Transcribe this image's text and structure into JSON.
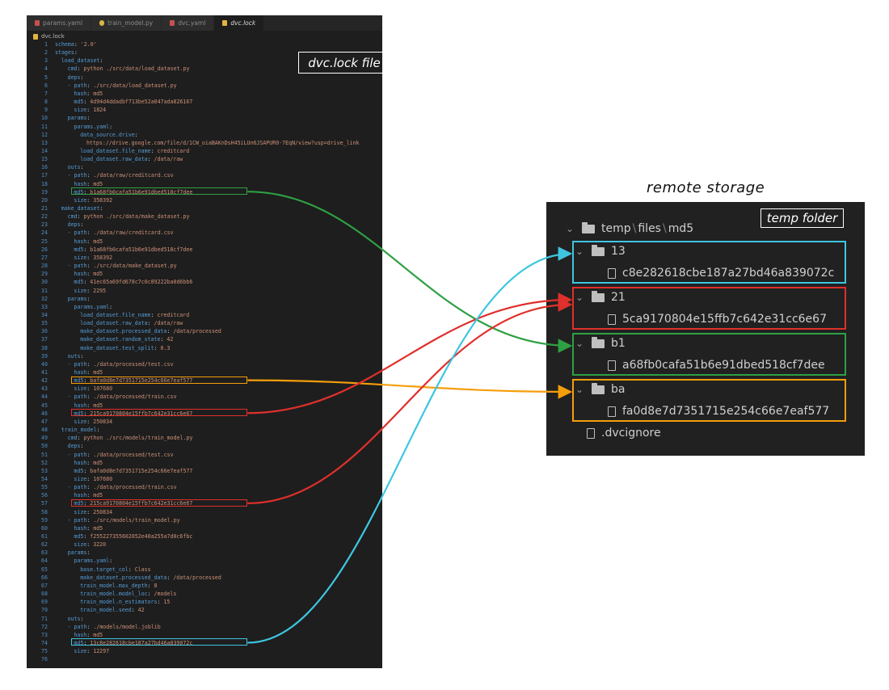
{
  "tabs": [
    {
      "label": "params.yaml",
      "icon": "yaml-icon",
      "active": false
    },
    {
      "label": "train_model.py",
      "icon": "python-icon",
      "active": false
    },
    {
      "label": "dvc.yaml",
      "icon": "yaml-icon",
      "active": false
    },
    {
      "label": "dvc.lock",
      "icon": "lock-icon",
      "active": true
    }
  ],
  "breadcrumb": "dvc.lock",
  "dvc_label": "dvc.lock file",
  "code_lines": [
    {
      "n": "1",
      "i": 0,
      "k": "schema",
      "v": "'2.0'"
    },
    {
      "n": "2",
      "i": 0,
      "k": "stages",
      "v": ""
    },
    {
      "n": "3",
      "i": 1,
      "k": "load_dataset",
      "v": ""
    },
    {
      "n": "4",
      "i": 2,
      "k": "cmd",
      "v": "python ./src/data/load_dataset.py"
    },
    {
      "n": "5",
      "i": 2,
      "k": "deps",
      "v": ""
    },
    {
      "n": "6",
      "i": 2,
      "k": "- path",
      "v": "./src/data/load_dataset.py"
    },
    {
      "n": "7",
      "i": 3,
      "k": "hash",
      "v": "md5"
    },
    {
      "n": "8",
      "i": 3,
      "k": "md5",
      "v": "4d94d4ddadbf713be52a047ada826167"
    },
    {
      "n": "9",
      "i": 3,
      "k": "size",
      "v": "1824"
    },
    {
      "n": "10",
      "i": 2,
      "k": "params",
      "v": ""
    },
    {
      "n": "11",
      "i": 3,
      "k": "params.yaml",
      "v": ""
    },
    {
      "n": "12",
      "i": 4,
      "k": "data_source.drive",
      "v": ""
    },
    {
      "n": "13",
      "i": 5,
      "k": "",
      "v": "https://drive.google.com/file/d/1CW_oiaBAKnDsH45iLUn6JSAPUR0-7EqN/view?usp=drive_link"
    },
    {
      "n": "14",
      "i": 4,
      "k": "load_dataset.file_name",
      "v": "creditcard"
    },
    {
      "n": "15",
      "i": 4,
      "k": "load_dataset.raw_data",
      "v": "/data/raw"
    },
    {
      "n": "16",
      "i": 2,
      "k": "outs",
      "v": ""
    },
    {
      "n": "17",
      "i": 2,
      "k": "- path",
      "v": "./data/raw/creditcard.csv"
    },
    {
      "n": "18",
      "i": 3,
      "k": "hash",
      "v": "md5"
    },
    {
      "n": "19",
      "i": 3,
      "k": "md5",
      "v": "b1a68fb0cafa51b6e91dbed518cf7dee"
    },
    {
      "n": "20",
      "i": 3,
      "k": "size",
      "v": "358392"
    },
    {
      "n": "21",
      "i": 1,
      "k": "make_dataset",
      "v": ""
    },
    {
      "n": "22",
      "i": 2,
      "k": "cmd",
      "v": "python ./src/data/make_dataset.py"
    },
    {
      "n": "23",
      "i": 2,
      "k": "deps",
      "v": ""
    },
    {
      "n": "24",
      "i": 2,
      "k": "- path",
      "v": "./data/raw/creditcard.csv"
    },
    {
      "n": "25",
      "i": 3,
      "k": "hash",
      "v": "md5"
    },
    {
      "n": "26",
      "i": 3,
      "k": "md5",
      "v": "b1a68fb0cafa51b6e91dbed518cf7dee"
    },
    {
      "n": "27",
      "i": 3,
      "k": "size",
      "v": "358392"
    },
    {
      "n": "28",
      "i": 2,
      "k": "- path",
      "v": "./src/data/make_dataset.py"
    },
    {
      "n": "29",
      "i": 3,
      "k": "hash",
      "v": "md5"
    },
    {
      "n": "30",
      "i": 3,
      "k": "md5",
      "v": "41ec65a69fd678c7c0c89222ba0d6bb6"
    },
    {
      "n": "31",
      "i": 3,
      "k": "size",
      "v": "2295"
    },
    {
      "n": "32",
      "i": 2,
      "k": "params",
      "v": ""
    },
    {
      "n": "33",
      "i": 3,
      "k": "params.yaml",
      "v": ""
    },
    {
      "n": "34",
      "i": 4,
      "k": "load_dataset.file_name",
      "v": "creditcard"
    },
    {
      "n": "35",
      "i": 4,
      "k": "load_dataset.raw_data",
      "v": "/data/raw"
    },
    {
      "n": "36",
      "i": 4,
      "k": "make_dataset.processed_data",
      "v": "/data/processed"
    },
    {
      "n": "37",
      "i": 4,
      "k": "make_dataset.random_state",
      "v": "42"
    },
    {
      "n": "38",
      "i": 4,
      "k": "make_dataset.test_split",
      "v": "0.3"
    },
    {
      "n": "39",
      "i": 2,
      "k": "outs",
      "v": ""
    },
    {
      "n": "40",
      "i": 2,
      "k": "- path",
      "v": "./data/processed/test.csv"
    },
    {
      "n": "41",
      "i": 3,
      "k": "hash",
      "v": "md5"
    },
    {
      "n": "42",
      "i": 3,
      "k": "md5",
      "v": "bafa0d8e7d7351715e254c66e7eaf577"
    },
    {
      "n": "43",
      "i": 3,
      "k": "size",
      "v": "107680"
    },
    {
      "n": "44",
      "i": 2,
      "k": "- path",
      "v": "./data/processed/train.csv"
    },
    {
      "n": "45",
      "i": 3,
      "k": "hash",
      "v": "md5"
    },
    {
      "n": "46",
      "i": 3,
      "k": "md5",
      "v": "215ca9170804e15ffb7c642e31cc6e67"
    },
    {
      "n": "47",
      "i": 3,
      "k": "size",
      "v": "250834"
    },
    {
      "n": "48",
      "i": 1,
      "k": "train_model",
      "v": ""
    },
    {
      "n": "49",
      "i": 2,
      "k": "cmd",
      "v": "python ./src/models/train_model.py"
    },
    {
      "n": "50",
      "i": 2,
      "k": "deps",
      "v": ""
    },
    {
      "n": "51",
      "i": 2,
      "k": "- path",
      "v": "./data/processed/test.csv"
    },
    {
      "n": "52",
      "i": 3,
      "k": "hash",
      "v": "md5"
    },
    {
      "n": "53",
      "i": 3,
      "k": "md5",
      "v": "bafa0d8e7d7351715e254c66e7eaf577"
    },
    {
      "n": "54",
      "i": 3,
      "k": "size",
      "v": "107680"
    },
    {
      "n": "55",
      "i": 2,
      "k": "- path",
      "v": "./data/processed/train.csv"
    },
    {
      "n": "56",
      "i": 3,
      "k": "hash",
      "v": "md5"
    },
    {
      "n": "57",
      "i": 3,
      "k": "md5",
      "v": "215ca9170804e15ffb7c642e31cc6e67"
    },
    {
      "n": "58",
      "i": 3,
      "k": "size",
      "v": "250834"
    },
    {
      "n": "59",
      "i": 2,
      "k": "- path",
      "v": "./src/models/train_model.py"
    },
    {
      "n": "60",
      "i": 3,
      "k": "hash",
      "v": "md5"
    },
    {
      "n": "61",
      "i": 3,
      "k": "md5",
      "v": "f255227355602052e40a255a7d0c6fbc"
    },
    {
      "n": "62",
      "i": 3,
      "k": "size",
      "v": "3220"
    },
    {
      "n": "63",
      "i": 2,
      "k": "params",
      "v": ""
    },
    {
      "n": "64",
      "i": 3,
      "k": "params.yaml",
      "v": ""
    },
    {
      "n": "65",
      "i": 4,
      "k": "base.target_col",
      "v": "Class"
    },
    {
      "n": "66",
      "i": 4,
      "k": "make_dataset.processed_data",
      "v": "/data/processed"
    },
    {
      "n": "67",
      "i": 4,
      "k": "train_model.max_depth",
      "v": "8"
    },
    {
      "n": "68",
      "i": 4,
      "k": "train_model.model_loc",
      "v": "/models"
    },
    {
      "n": "69",
      "i": 4,
      "k": "train_model.n_estimators",
      "v": "15"
    },
    {
      "n": "70",
      "i": 4,
      "k": "train_model.seed",
      "v": "42"
    },
    {
      "n": "71",
      "i": 2,
      "k": "outs",
      "v": ""
    },
    {
      "n": "72",
      "i": 2,
      "k": "- path",
      "v": "./models/model.joblib"
    },
    {
      "n": "73",
      "i": 3,
      "k": "hash",
      "v": "md5"
    },
    {
      "n": "74",
      "i": 3,
      "k": "md5",
      "v": "13c8e282618cbe187a27bd46a839072c"
    },
    {
      "n": "75",
      "i": 3,
      "k": "size",
      "v": "12297"
    },
    {
      "n": "76",
      "i": 0,
      "k": "",
      "v": ""
    }
  ],
  "code_highlights": [
    {
      "line": "19",
      "color": "#2ea043"
    },
    {
      "line": "42",
      "color": "#f59e0b"
    },
    {
      "line": "46",
      "color": "#e0302b"
    },
    {
      "line": "57",
      "color": "#e0302b"
    },
    {
      "line": "74",
      "color": "#3ec6e0"
    }
  ],
  "remote": {
    "title": "remote storage",
    "temp_label": "temp folder",
    "root_path": [
      "temp",
      "files",
      "md5"
    ],
    "folders": [
      {
        "name": "13",
        "file": "c8e282618cbe187a27bd46a839072c",
        "color": "#3ec6e0"
      },
      {
        "name": "21",
        "file": "5ca9170804e15ffb7c642e31cc6e67",
        "color": "#e0302b"
      },
      {
        "name": "b1",
        "file": "a68fb0cafa51b6e91dbed518cf7dee",
        "color": "#2ea043"
      },
      {
        "name": "ba",
        "file": "fa0d8e7d7351715e254c66e7eaf577",
        "color": "#f59e0b"
      }
    ],
    "dvcignore": ".dvcignore"
  }
}
